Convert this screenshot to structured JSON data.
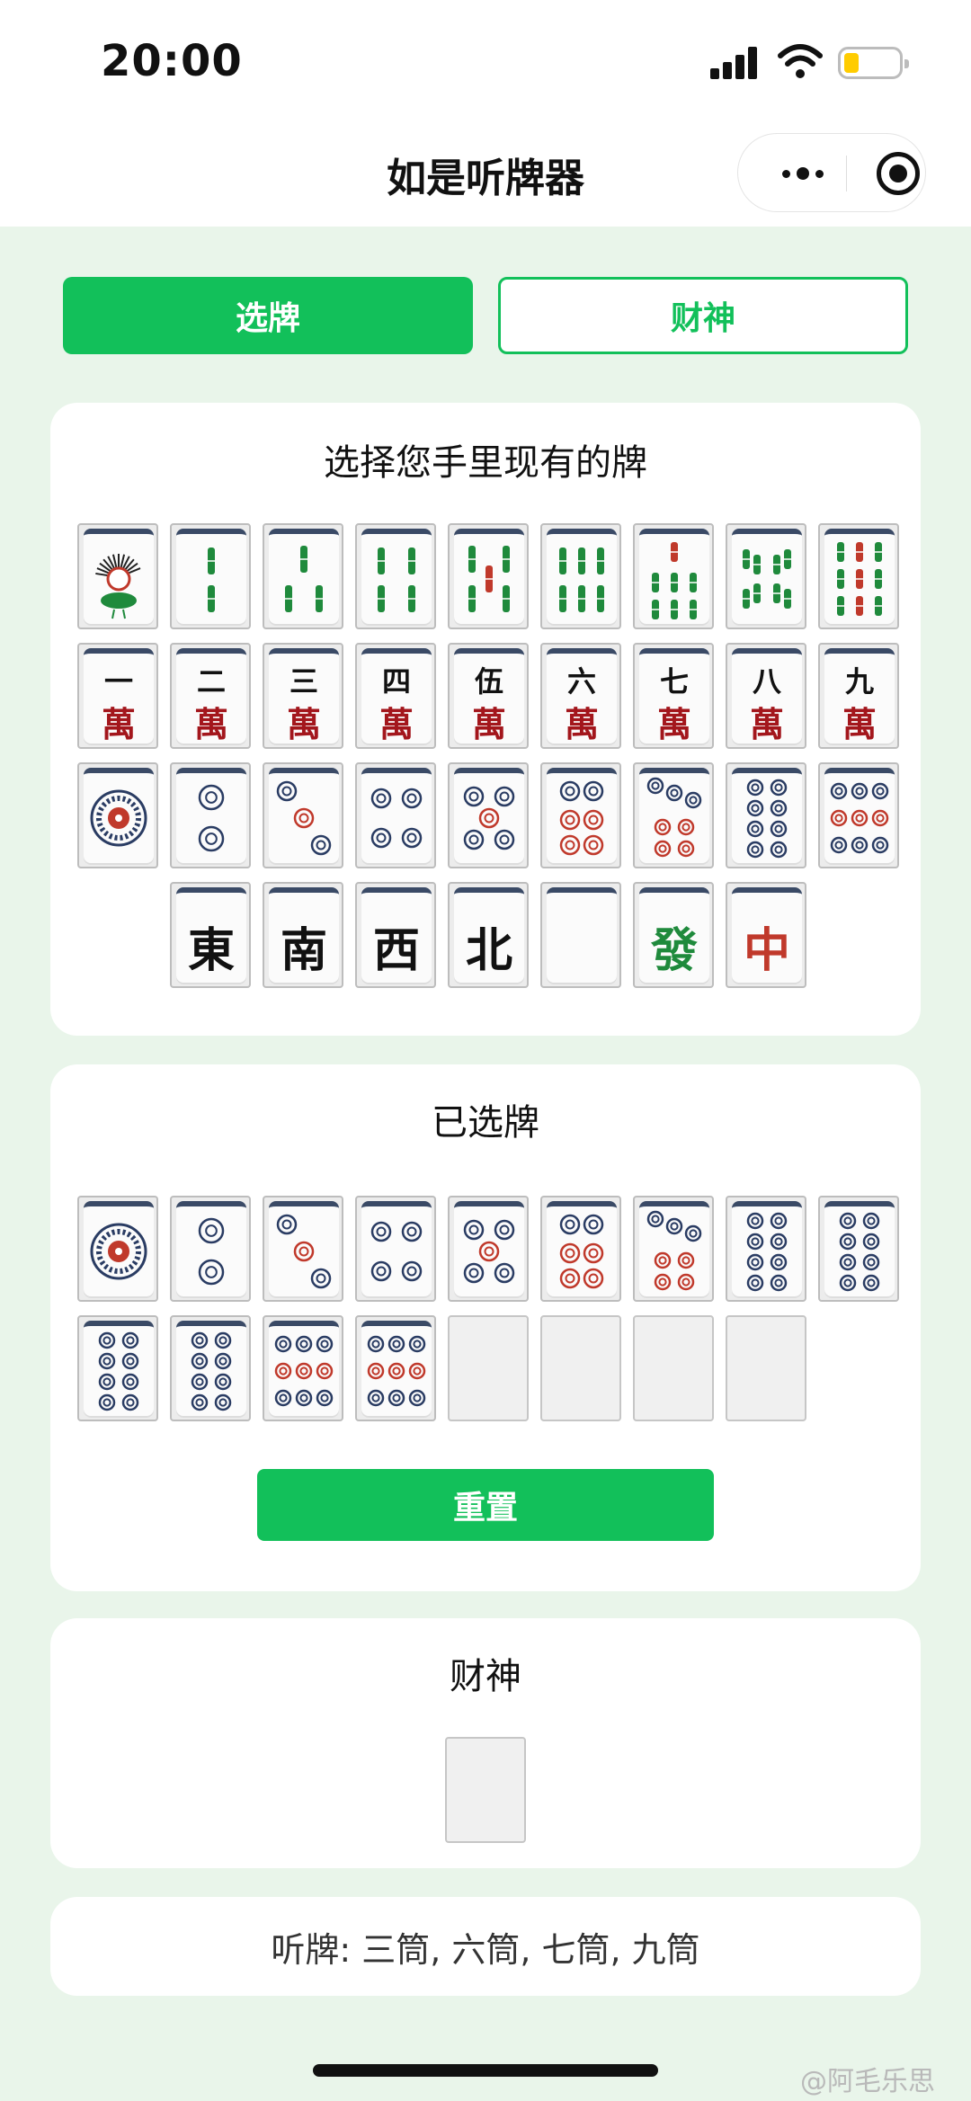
{
  "status_bar": {
    "time": "20:00"
  },
  "nav": {
    "title": "如是听牌器"
  },
  "tabs": [
    {
      "label": "选牌",
      "active": true
    },
    {
      "label": "财神",
      "active": false
    }
  ],
  "picker": {
    "title": "选择您手里现有的牌",
    "rows": [
      [
        "1条",
        "2条",
        "3条",
        "4条",
        "5条",
        "6条",
        "7条",
        "8条",
        "9条"
      ],
      [
        "一万",
        "二万",
        "三万",
        "四万",
        "五万",
        "六万",
        "七万",
        "八万",
        "九万"
      ],
      [
        "1筒",
        "2筒",
        "3筒",
        "4筒",
        "5筒",
        "6筒",
        "7筒",
        "8筒",
        "9筒"
      ],
      [
        "東",
        "南",
        "西",
        "北",
        "白",
        "發",
        "中"
      ]
    ]
  },
  "selected": {
    "title": "已选牌",
    "tiles": [
      "1筒",
      "2筒",
      "3筒",
      "4筒",
      "5筒",
      "6筒",
      "7筒",
      "8筒",
      "8筒",
      "8筒",
      "8筒",
      "9筒",
      "9筒"
    ],
    "empty_slots": 4,
    "reset_label": "重置"
  },
  "wild": {
    "title": "财神",
    "empty_slots": 1
  },
  "result": {
    "text": "听牌: 三筒, 六筒, 七筒, 九筒"
  },
  "watermark": "@阿毛乐思",
  "colors": {
    "accent": "#12c05a",
    "background": "#e9f5ea",
    "bamboo": "#1f8a3c",
    "dot_blue": "#2a3c63",
    "dot_red": "#c0392b",
    "char_red": "#a3161c"
  }
}
